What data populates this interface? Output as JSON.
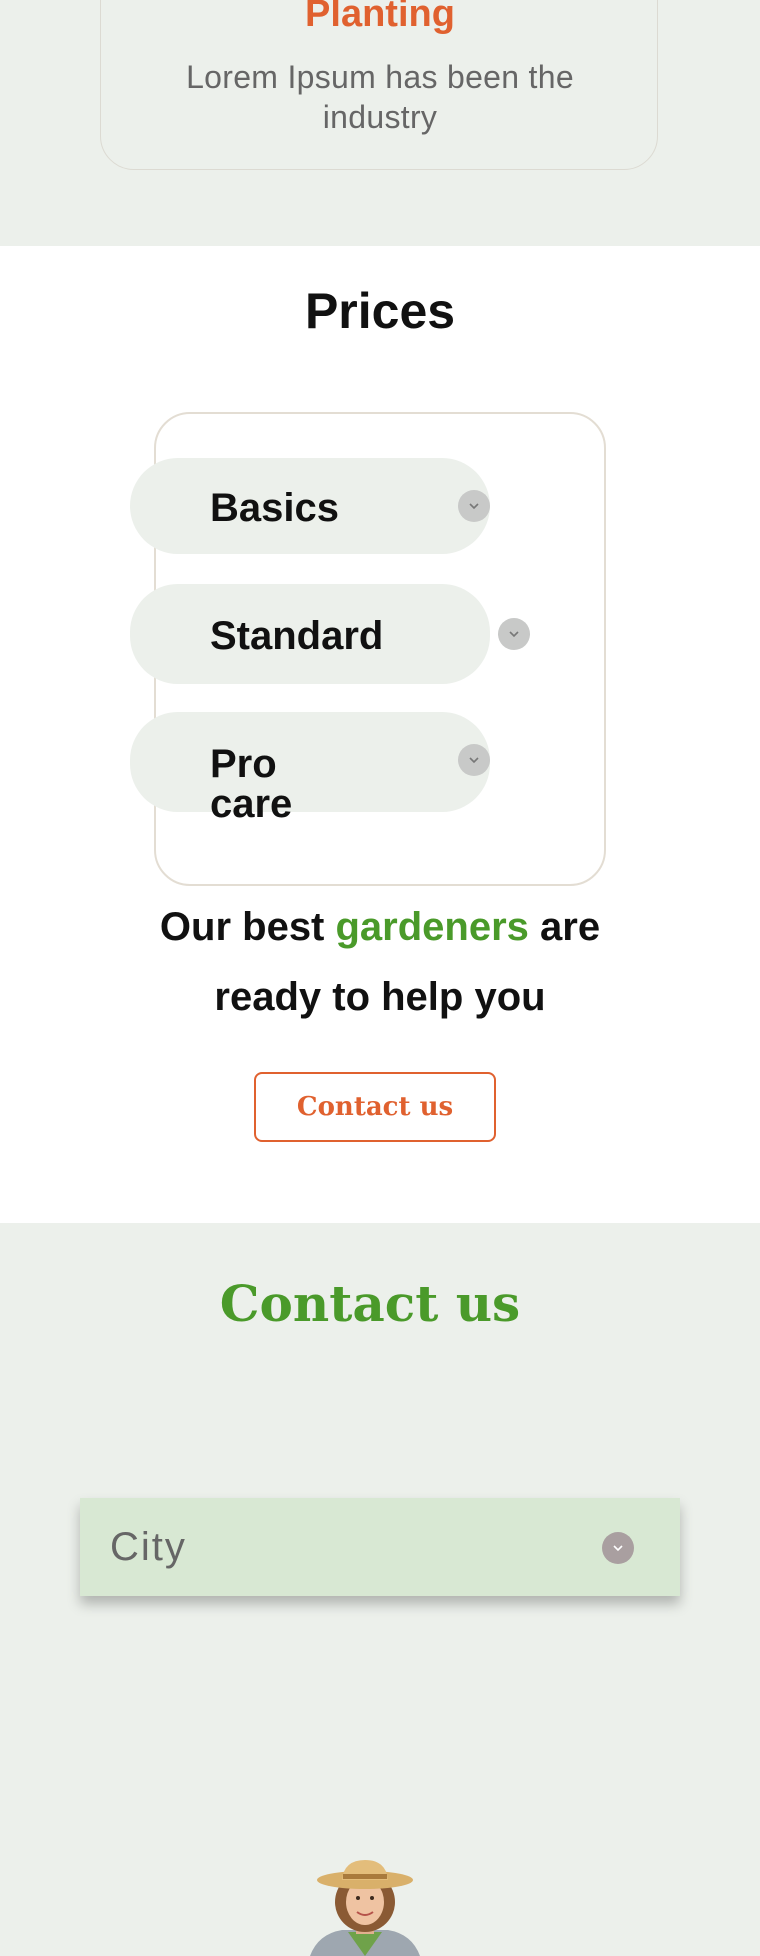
{
  "top_card": {
    "title": "Planting",
    "text": "Lorem Ipsum has been the industry"
  },
  "prices": {
    "title": "Prices",
    "plans": [
      {
        "label": "Basics",
        "icon": "chevron-down-icon"
      },
      {
        "label": "Standard",
        "icon": "chevron-down-icon"
      },
      {
        "label": "Pro care",
        "icon": "chevron-down-icon"
      }
    ]
  },
  "cta": {
    "line1_start": "Our best ",
    "line1_highlight": "gardeners",
    "line1_end": " are",
    "line2": "ready to help you",
    "button_label": "Contact us"
  },
  "contact": {
    "title": "Contact us",
    "city_select": {
      "value": "City",
      "icon": "chevron-down-icon"
    }
  },
  "colors": {
    "accent_orange": "#e0612f",
    "accent_green": "#4a9a2a",
    "section_bg": "#ecf0eb",
    "select_bg": "#d8e8d3"
  }
}
